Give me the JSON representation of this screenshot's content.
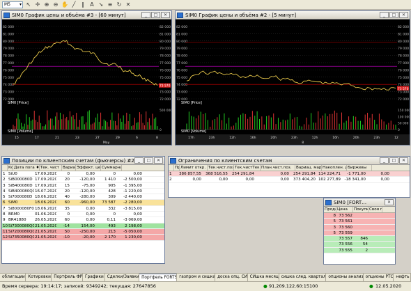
{
  "toolbar": {
    "interval": "M5"
  },
  "chart1": {
    "title": "SIМ0 График цены и объёма #3 - [60 минут]",
    "price_label": "SIМ0 [Price]",
    "volume_label": "SIМ0 [Volume]",
    "y_ticks": [
      "82 000",
      "81 000",
      "80 000",
      "79 000",
      "78 000",
      "77 000",
      "76 000",
      "75 000",
      "74 000",
      "73 000",
      "72 000"
    ],
    "last_price": "73 570",
    "vol_ticks": [
      "500 000",
      "0"
    ],
    "x_ticks": [
      "15",
      "17",
      "21",
      "23",
      "27",
      "29",
      "6",
      "8"
    ],
    "x_month": "May"
  },
  "chart2": {
    "title": "SIМ0 График цены и объёма #2 - [5 минут]",
    "price_label": "SIМ0 [Price]",
    "volume_label": "SIМ0 [Volume]",
    "y_ticks": [
      "82 000",
      "81 000",
      "80 000",
      "79 000",
      "78 000",
      "77 000",
      "76 000",
      "75 000",
      "74 000",
      "73 000",
      "72 000"
    ],
    "last_price": "73 570",
    "vol_ticks": [
      "150 000",
      "100 000",
      "50 000",
      "0"
    ],
    "x_ticks": [
      "17h",
      "23h",
      "12h",
      "16h",
      "20h",
      "23h",
      "12h",
      "16h",
      "20h",
      "23h",
      "12"
    ],
    "x_day": "8"
  },
  "positions": {
    "title": "Позиции по клиентским счетам (фьючерсы) #2",
    "columns": [
      "Код инструмента",
      "Дата пога ♦",
      "Тек. чист",
      "Вариац. маржа",
      "Эффект. цена",
      "Суммарная в."
    ],
    "rows": [
      [
        "SiU0",
        "17.09.2020",
        "0",
        "0,00",
        "0",
        "0,00"
      ],
      [
        "SiB000080D",
        "17.09.2020",
        "20",
        "-120,00",
        "1 410",
        "-2 500,00"
      ],
      [
        "SiB400080D",
        "17.09.2020",
        "15",
        "-75,00",
        "905",
        "-1 395,00"
      ],
      [
        "SiB400080Q0",
        "16.07.2020",
        "20",
        "-120,00",
        "428",
        "-1 220,00"
      ],
      [
        "Si7000080D",
        "18.06.2020",
        "40",
        "-280,00",
        "309",
        "-2 440,00"
      ],
      [
        "SiM0",
        "18.06.2020",
        "60",
        "-960,00",
        "73 587",
        "-2 280,00"
      ],
      [
        "Si8000080F0",
        "18.06.2020",
        "35",
        "0,00",
        "332",
        "-3 815,00"
      ],
      [
        "BRM0",
        "01.06.2020",
        "0",
        "0,00",
        "0",
        "0,00"
      ],
      [
        "BR41880",
        "26.05.2020",
        "60",
        "0,00",
        "0,11",
        "-3 069,00"
      ],
      [
        "Si7300080Q0",
        "21.05.2020",
        "-14",
        "154,00",
        "493",
        "2 198,00"
      ],
      [
        "Si7200080Q0",
        "21.05.2020",
        "50",
        "-250,00",
        "213",
        "-5 050,00"
      ],
      [
        "Si7350080Q0",
        "21.05.2020",
        "-10",
        "-20,00",
        "2 170",
        "1 230,00"
      ]
    ]
  },
  "limits": {
    "title": "Ограничения по клиентским счетам",
    "columns": [
      "Предыд. лим.",
      "Лимит откр. по",
      "Тек.чист.поз.",
      "Тек.чистТек.чист.поз.",
      "План.чист.поз.",
      "Вариац. маржа",
      "Накоплен. доход",
      "Биржевы"
    ],
    "rows": [
      [
        "386 857,55",
        "368 516,55",
        "254 291,84",
        "0,00",
        "254 291,84",
        "114 224,71",
        "-1 771,00",
        "0,00"
      ],
      [
        "0,00",
        "0,00",
        "0,00",
        "0,00",
        "373 404,20",
        "102 277,89",
        "-18 341,00",
        "0,00"
      ]
    ]
  },
  "quotes": {
    "title": "SIМ0 [FORT…",
    "columns": [
      "Продаж",
      "Цена",
      "Покупка",
      "Своя пр",
      "Сво"
    ],
    "rows": [
      [
        "8",
        "73 562",
        "",
        ""
      ],
      [
        "5",
        "73 561",
        "",
        ""
      ],
      [
        "3",
        "73 560",
        "",
        ""
      ],
      [
        "5",
        "73 559",
        "",
        ""
      ],
      [
        "",
        "73 557",
        "846",
        ""
      ],
      [
        "",
        "73 556",
        "54",
        ""
      ],
      [
        "",
        "73 555",
        "2",
        ""
      ]
    ]
  },
  "tabs": [
    "облигации",
    "Котировки",
    "Портфель ФР",
    "Графики",
    "Сделки/Заявки",
    "Портфель FORTS",
    "газпром и сишка",
    "доска опц. СИ",
    "СИшка месяц",
    "сишка след. квартал.",
    "опционы анализ",
    "опционы РТС",
    "нефть"
  ],
  "active_tab": "Портфель FORTS",
  "status": {
    "server_time": "Время сервера: 19:14:17; записей: 9349242; текущая: 27647856",
    "ip": "91.209.122.60:15100",
    "date": "12.05.2020"
  }
}
